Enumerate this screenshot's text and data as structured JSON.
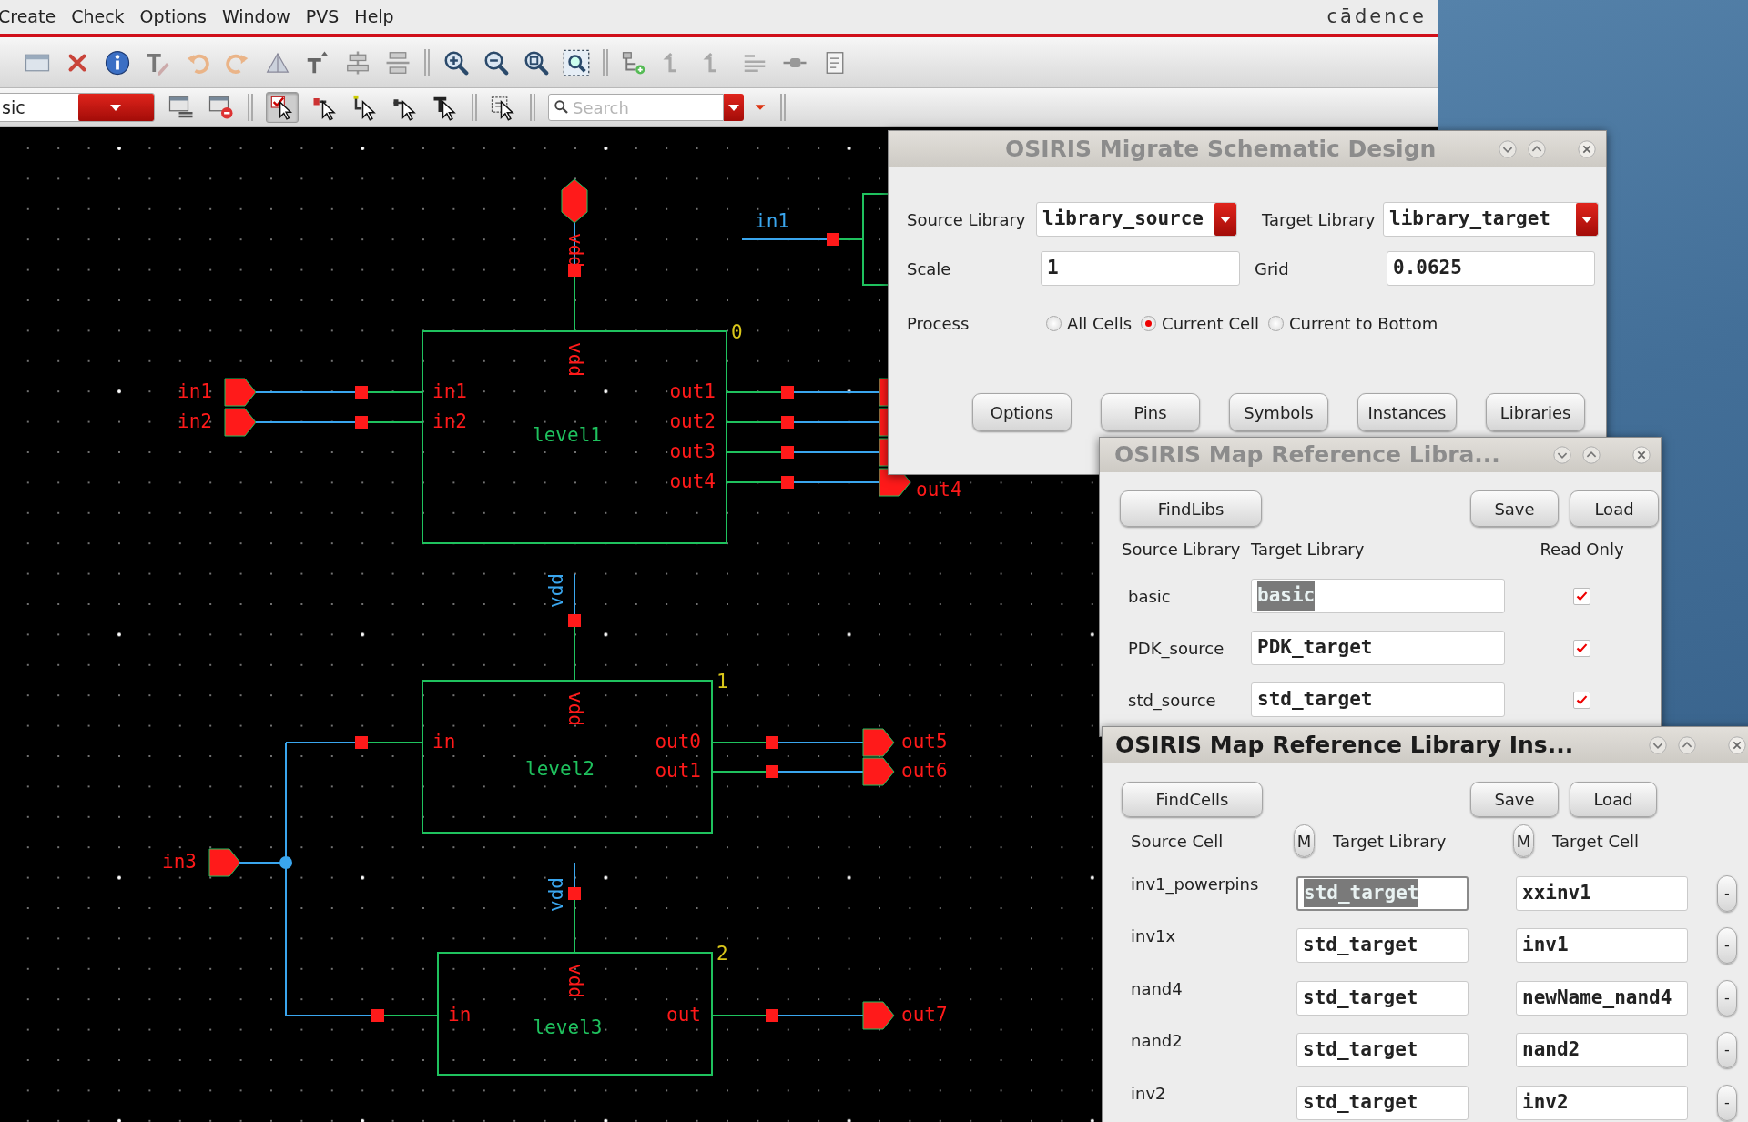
{
  "menu": [
    "Create",
    "Check",
    "Options",
    "Window",
    "PVS",
    "Help"
  ],
  "brand": "cādence",
  "toolbar": {
    "cellview_combo": {
      "value": "sic"
    },
    "search": {
      "placeholder": "Search"
    },
    "select_tools": [
      {
        "kind": "check",
        "selected": true
      },
      {
        "kind": "pin",
        "selected": false
      },
      {
        "kind": "wire",
        "selected": false
      },
      {
        "kind": "net",
        "selected": false
      },
      {
        "kind": "text",
        "selected": false
      }
    ]
  },
  "schematic": {
    "instances": [
      {
        "name": "level1",
        "number": "0",
        "supply_pin": "vdd",
        "supply_net": {
          "label": "vdd",
          "kind": "pin"
        },
        "inputs": [
          "in1",
          "in2"
        ],
        "outputs": [
          "out1",
          "out2",
          "out3",
          "out4"
        ]
      },
      {
        "name": "level2",
        "number": "1",
        "supply_pin": "vdd",
        "supply_net": {
          "label": "vdd",
          "kind": "wire"
        },
        "inputs": [
          "in"
        ],
        "outputs": [
          "out0",
          "out1"
        ]
      },
      {
        "name": "level3",
        "number": "2",
        "supply_pin": "vdd",
        "supply_net": {
          "label": "vdd",
          "kind": "wire"
        },
        "inputs": [
          "in"
        ],
        "outputs": [
          "out"
        ]
      }
    ],
    "input_pins": [
      "in1",
      "in2",
      "in3"
    ],
    "output_pins": [
      "out4",
      "out5",
      "out6",
      "out7"
    ],
    "net_labels": [
      "in1"
    ]
  },
  "migrate_dialog": {
    "title": "OSIRIS Migrate Schematic Design",
    "active": false,
    "source_library": {
      "label": "Source Library",
      "value": "library_source"
    },
    "target_library": {
      "label": "Target Library",
      "value": "library_target"
    },
    "scale": {
      "label": "Scale",
      "value": "1"
    },
    "grid": {
      "label": "Grid",
      "value": "0.0625"
    },
    "process": {
      "label": "Process",
      "options": [
        {
          "label": "All Cells",
          "selected": false
        },
        {
          "label": "Current Cell",
          "selected": true
        },
        {
          "label": "Current to Bottom",
          "selected": false
        }
      ]
    },
    "buttons": [
      "Options",
      "Pins",
      "Symbols",
      "Instances",
      "Libraries"
    ]
  },
  "library_map_dialog": {
    "title": "OSIRIS Map Reference Libra...",
    "active": false,
    "find_button": "FindLibs",
    "save_button": "Save",
    "load_button": "Load",
    "columns": [
      "Source Library",
      "Target Library",
      "Read Only"
    ],
    "rows": [
      {
        "source": "basic",
        "target": "basic",
        "target_selected": true,
        "read_only": true
      },
      {
        "source": "PDK_source",
        "target": "PDK_target",
        "target_selected": false,
        "read_only": true
      },
      {
        "source": "std_source",
        "target": "std_target",
        "target_selected": false,
        "read_only": true
      }
    ]
  },
  "instance_map_dialog": {
    "title": "OSIRIS Map Reference Library Ins...",
    "active": true,
    "find_button": "FindCells",
    "save_button": "Save",
    "load_button": "Load",
    "columns": [
      {
        "label": "Source Cell"
      },
      {
        "label": "Target Library",
        "button": "M"
      },
      {
        "label": "Target Cell",
        "button": "M"
      }
    ],
    "rows": [
      {
        "source": "inv1_powerpins",
        "library": "std_target",
        "library_selected": true,
        "cell": "xxinv1",
        "remove_button": "-"
      },
      {
        "source": "inv1x",
        "library": "std_target",
        "library_selected": false,
        "cell": "inv1",
        "remove_button": "-"
      },
      {
        "source": "nand4",
        "library": "std_target",
        "library_selected": false,
        "cell": "newName_nand4",
        "remove_button": "-"
      },
      {
        "source": "nand2",
        "library": "std_target",
        "library_selected": false,
        "cell": "nand2",
        "remove_button": "-"
      },
      {
        "source": "inv2",
        "library": "std_target",
        "library_selected": false,
        "cell": "inv2",
        "remove_button": "-"
      }
    ]
  }
}
